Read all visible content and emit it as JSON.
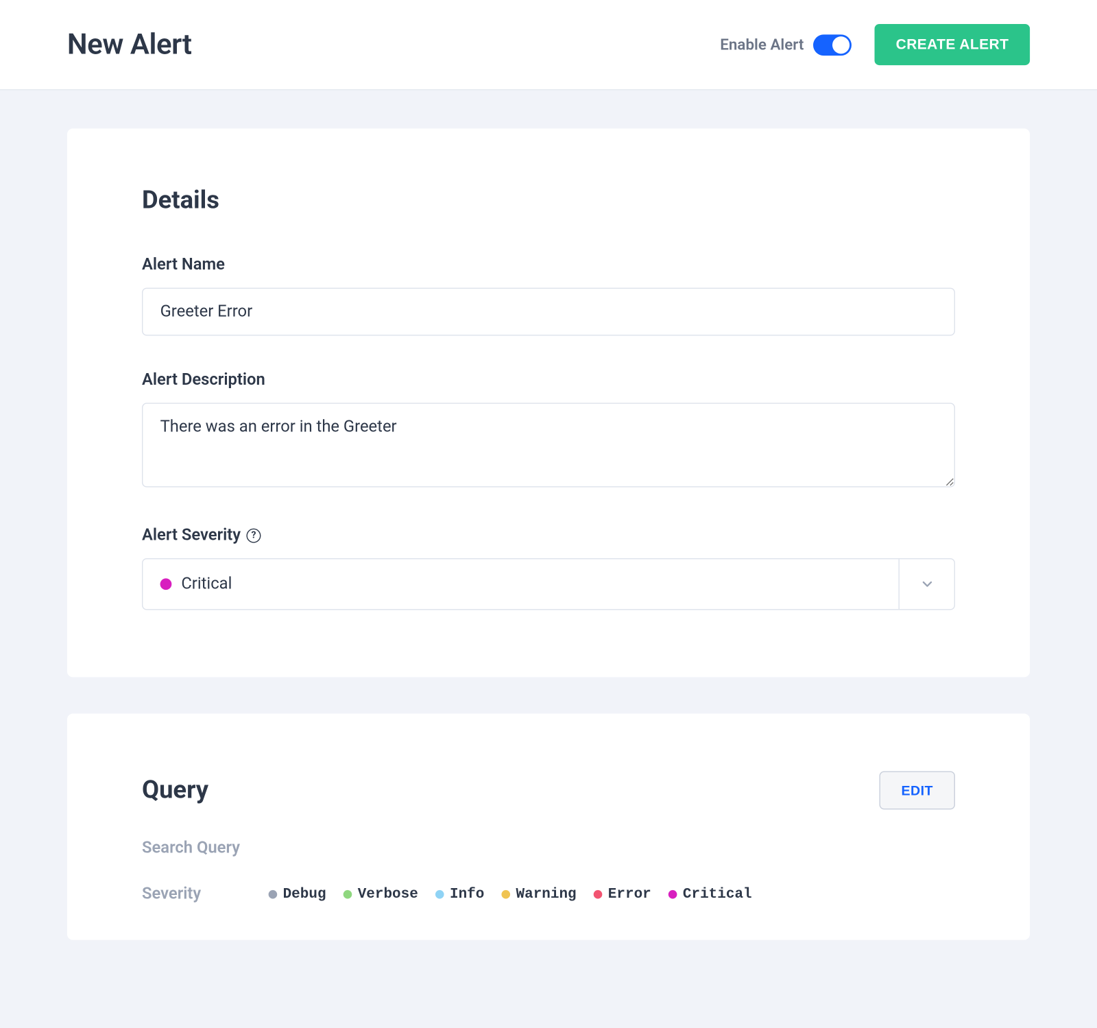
{
  "header": {
    "title": "New Alert",
    "enable_label": "Enable Alert",
    "enable_state": true,
    "create_button": "CREATE ALERT"
  },
  "details": {
    "section_title": "Details",
    "alert_name_label": "Alert Name",
    "alert_name_value": "Greeter Error",
    "alert_description_label": "Alert Description",
    "alert_description_value": "There was an error in the Greeter",
    "alert_severity_label": "Alert Severity",
    "alert_severity_selected": "Critical",
    "alert_severity_color": "#d81fbf"
  },
  "query": {
    "section_title": "Query",
    "edit_button": "EDIT",
    "search_query_label": "Search Query",
    "search_query_value": "",
    "severity_label": "Severity",
    "severities": [
      {
        "name": "Debug",
        "color": "#9aa3b4"
      },
      {
        "name": "Verbose",
        "color": "#8fd77f"
      },
      {
        "name": "Info",
        "color": "#8fd3f5"
      },
      {
        "name": "Warning",
        "color": "#f0c452"
      },
      {
        "name": "Error",
        "color": "#f25471"
      },
      {
        "name": "Critical",
        "color": "#d81fbf"
      }
    ]
  }
}
